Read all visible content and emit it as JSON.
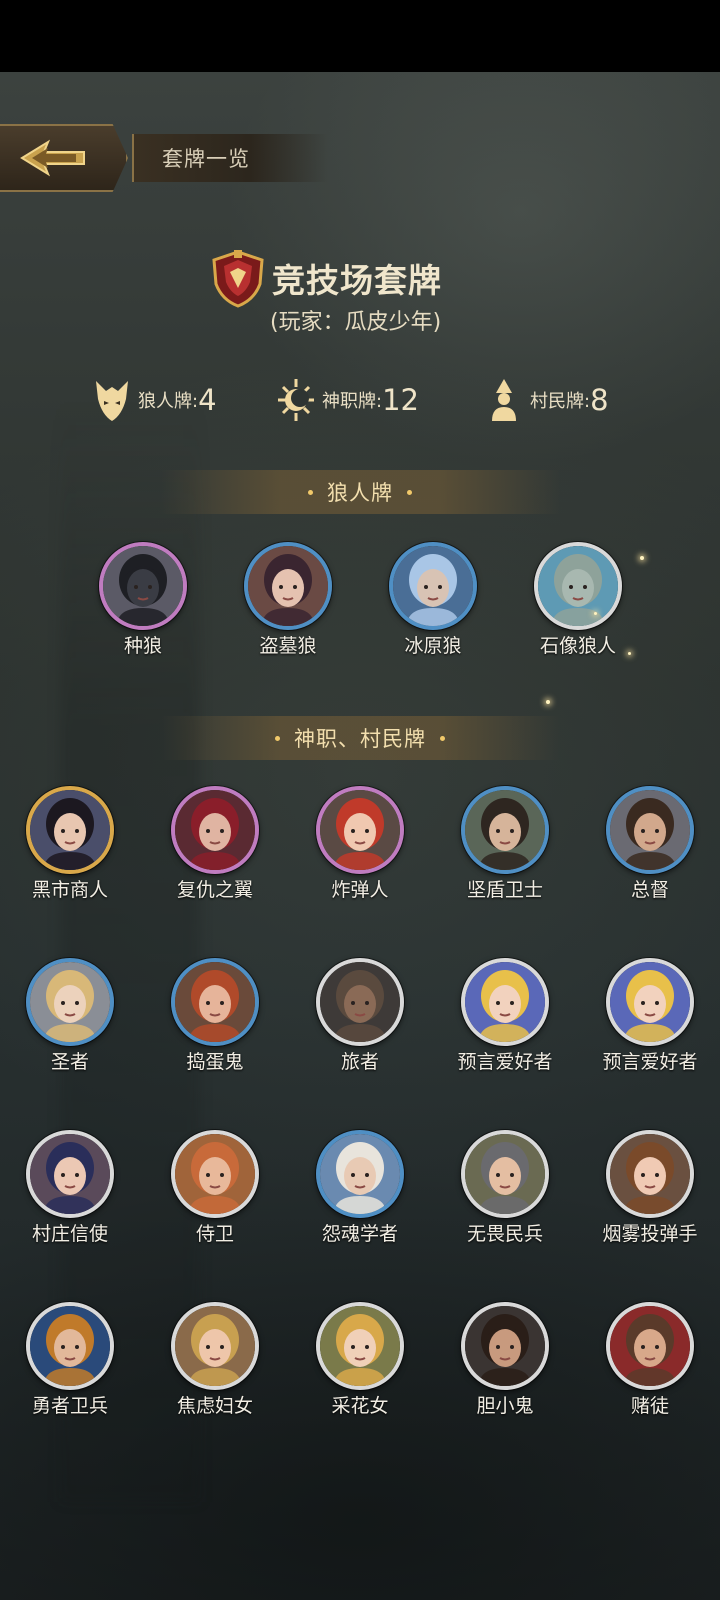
{
  "header": {
    "title": "套牌一览"
  },
  "deck": {
    "title": "竞技场套牌",
    "player": "(玩家：瓜皮少年)"
  },
  "counts": [
    {
      "icon": "wolf-icon",
      "label": "狼人牌:",
      "value": "4"
    },
    {
      "icon": "sun-moon-icon",
      "label": "神职牌:",
      "value": "12"
    },
    {
      "icon": "villager-icon",
      "label": "村民牌:",
      "value": "8"
    }
  ],
  "sections": {
    "werewolf": "狼人牌",
    "gods_villagers": "神职、村民牌"
  },
  "werewolves": [
    {
      "name": "种狼",
      "ring": "#c07cc0",
      "skin": "#3a3c44",
      "hair": "#1e1f24",
      "bg": "#5b5a66"
    },
    {
      "name": "盗墓狼",
      "ring": "#4f8fc4",
      "skin": "#e5c2b0",
      "hair": "#3a2530",
      "bg": "#6a4a44"
    },
    {
      "name": "冰原狼",
      "ring": "#4f8fc4",
      "skin": "#d8c3b4",
      "hair": "#a9c6e6",
      "bg": "#4a6e96"
    },
    {
      "name": "石像狼人",
      "ring": "#d9d9d9",
      "skin": "#a8b8b0",
      "hair": "#8ea29a",
      "bg": "#5e9ab4"
    }
  ],
  "roles": [
    {
      "name": "黑市商人",
      "ring": "#d9a84a",
      "skin": "#e8c6b0",
      "hair": "#1c1820",
      "bg": "#4a4e6a"
    },
    {
      "name": "复仇之翼",
      "ring": "#c07cc0",
      "skin": "#e0b4a2",
      "hair": "#8a1e2a",
      "bg": "#5a2a32"
    },
    {
      "name": "炸弹人",
      "ring": "#c07cc0",
      "skin": "#f0c8b0",
      "hair": "#c03a2a",
      "bg": "#5a4a44"
    },
    {
      "name": "坚盾卫士",
      "ring": "#4f8fc4",
      "skin": "#d6b49a",
      "hair": "#2e2620",
      "bg": "#5a6658"
    },
    {
      "name": "总督",
      "ring": "#4f8fc4",
      "skin": "#d2a88c",
      "hair": "#3a2a20",
      "bg": "#6a6a72"
    },
    {
      "name": "圣者",
      "ring": "#4f8fc4",
      "skin": "#ecd2bc",
      "hair": "#d8b878",
      "bg": "#8a8e96"
    },
    {
      "name": "捣蛋鬼",
      "ring": "#4f8fc4",
      "skin": "#e6b49a",
      "hair": "#b04a2a",
      "bg": "#6a4a3a"
    },
    {
      "name": "旅者",
      "ring": "#d9d9d9",
      "skin": "#8a6a56",
      "hair": "#5a4a3e",
      "bg": "#3e3a38"
    },
    {
      "name": "预言爱好者",
      "ring": "#d9d9d9",
      "skin": "#f2d2be",
      "hair": "#e8c04a",
      "bg": "#5a68b8"
    },
    {
      "name": "预言爱好者",
      "ring": "#d9d9d9",
      "skin": "#f2d2be",
      "hair": "#e8c04a",
      "bg": "#5a68b8"
    },
    {
      "name": "村庄信使",
      "ring": "#d9d9d9",
      "skin": "#ecc8b4",
      "hair": "#2a2e5a",
      "bg": "#5a4a5a"
    },
    {
      "name": "侍卫",
      "ring": "#d9d9d9",
      "skin": "#e8b89a",
      "hair": "#c86a3a",
      "bg": "#a0643a"
    },
    {
      "name": "怨魂学者",
      "ring": "#4f8fc4",
      "skin": "#e8cab4",
      "hair": "#e8e4dc",
      "bg": "#6a8ab0"
    },
    {
      "name": "无畏民兵",
      "ring": "#d9d9d9",
      "skin": "#e4bea2",
      "hair": "#6a6a6e",
      "bg": "#6a6a52"
    },
    {
      "name": "烟雾投弹手",
      "ring": "#d9d9d9",
      "skin": "#f0cab4",
      "hair": "#7a4a2a",
      "bg": "#6a5040"
    },
    {
      "name": "勇者卫兵",
      "ring": "#d9d9d9",
      "skin": "#e2b89a",
      "hair": "#c07a2a",
      "bg": "#2a4a7a"
    },
    {
      "name": "焦虑妇女",
      "ring": "#d9d9d9",
      "skin": "#eec6aa",
      "hair": "#c8a050",
      "bg": "#8a6a4a"
    },
    {
      "name": "采花女",
      "ring": "#d9d9d9",
      "skin": "#f0d0b8",
      "hair": "#d8a84a",
      "bg": "#7a7a4a"
    },
    {
      "name": "胆小鬼",
      "ring": "#d9d9d9",
      "skin": "#c89a7e",
      "hair": "#2a1e18",
      "bg": "#3a3432"
    },
    {
      "name": "赌徒",
      "ring": "#d9d9d9",
      "skin": "#d8a88a",
      "hair": "#5a3a2a",
      "bg": "#8a2a2a"
    }
  ]
}
